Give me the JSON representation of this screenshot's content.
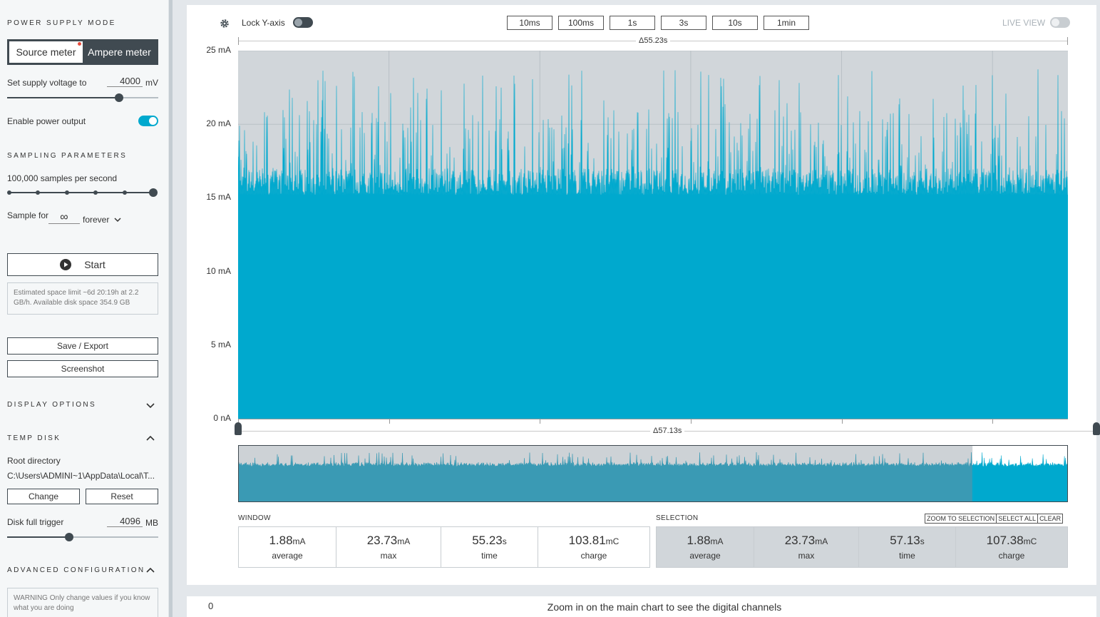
{
  "sidebar": {
    "power_supply_mode_title": "POWER SUPPLY MODE",
    "mode_source": "Source meter",
    "mode_ampere": "Ampere meter",
    "supply_voltage_label": "Set supply voltage to",
    "supply_voltage_value": "4000",
    "supply_voltage_unit": "mV",
    "supply_voltage_level": 0.74,
    "enable_power_label": "Enable power output",
    "enable_power_on": true,
    "sampling_title": "SAMPLING PARAMETERS",
    "sample_rate_label": "100,000 samples per second",
    "sample_rate_steps": 6,
    "sample_rate_selected": 6,
    "sample_for_label": "Sample for",
    "sample_for_value": "∞",
    "sample_for_unit": "forever",
    "start_label": "Start",
    "space_info": "Estimated space limit ~6d 20:19h at 2.2 GB/h. Available disk space 354.9 GB",
    "save_export_label": "Save / Export",
    "screenshot_label": "Screenshot",
    "display_options_title": "DISPLAY OPTIONS",
    "temp_disk_title": "TEMP DISK",
    "root_dir_label": "Root directory",
    "root_dir_path": "C:\\Users\\ADMINI~1\\AppData\\Local\\T...",
    "change_label": "Change",
    "reset_label": "Reset",
    "disk_full_label": "Disk full trigger",
    "disk_full_value": "4096",
    "disk_full_unit": "MB",
    "disk_full_level": 0.41,
    "advanced_title": "ADVANCED CONFIGURATION",
    "warning_text": "WARNING Only change values if you know what you are doing"
  },
  "toolbar": {
    "lock_y_label": "Lock Y-axis",
    "window_buttons": [
      "10ms",
      "100ms",
      "1s",
      "3s",
      "10s",
      "1min"
    ],
    "live_view_label": "LIVE VIEW"
  },
  "chart_data": {
    "type": "area",
    "ylabel_ticks": [
      "25 mA",
      "20 mA",
      "15 mA",
      "10 mA",
      "5 mA",
      "0 nA"
    ],
    "y_ticks": [
      25,
      20,
      15,
      10,
      5,
      0
    ],
    "ylim": [
      0,
      25
    ],
    "y_unit": "mA",
    "window_delta": "Δ55.23s",
    "window_seconds": 55.23,
    "selection_delta": "Δ57.13s",
    "selection_seconds": 57.13,
    "base_level": 15.2,
    "peak_level": 23.73,
    "avg_level": 1.88,
    "grid": true,
    "color": "#00a9ce",
    "background": "#d1d6da",
    "minimap_window_fraction": 0.885
  },
  "stats": {
    "window_title": "WINDOW",
    "selection_title": "SELECTION",
    "zoom_to_selection": "ZOOM TO SELECTION",
    "select_all": "SELECT ALL",
    "clear": "CLEAR",
    "window": [
      {
        "value": "1.88",
        "unit": "mA",
        "label": "average"
      },
      {
        "value": "23.73",
        "unit": "mA",
        "label": "max"
      },
      {
        "value": "55.23",
        "unit": "s",
        "label": "time"
      },
      {
        "value": "103.81",
        "unit": "mC",
        "label": "charge"
      }
    ],
    "selection": [
      {
        "value": "1.88",
        "unit": "mA",
        "label": "average"
      },
      {
        "value": "23.73",
        "unit": "mA",
        "label": "max"
      },
      {
        "value": "57.13",
        "unit": "s",
        "label": "time"
      },
      {
        "value": "107.38",
        "unit": "mC",
        "label": "charge"
      }
    ]
  },
  "digital": {
    "channel_value": "0",
    "message": "Zoom in on the main chart to see the digital channels"
  }
}
